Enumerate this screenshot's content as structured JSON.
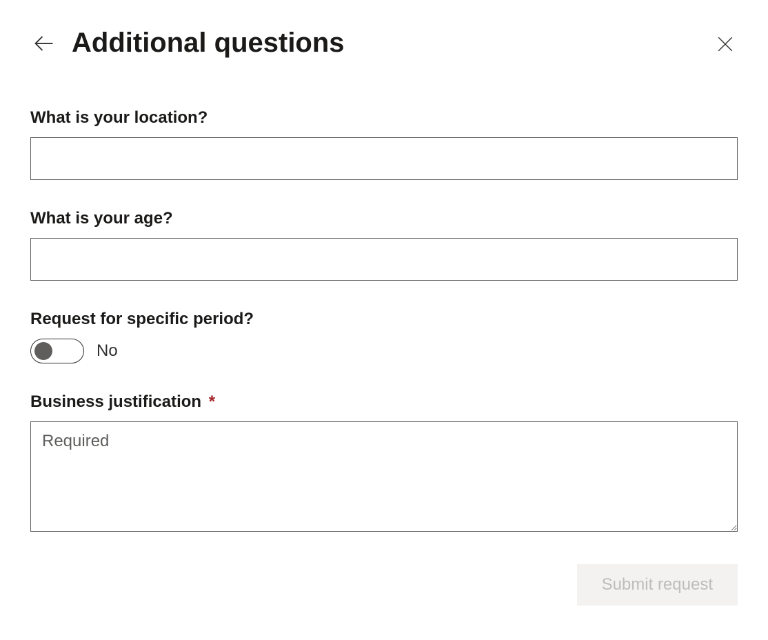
{
  "header": {
    "title": "Additional questions"
  },
  "fields": {
    "location": {
      "label": "What is your location?",
      "value": ""
    },
    "age": {
      "label": "What is your age?",
      "value": ""
    },
    "specificPeriod": {
      "label": "Request for specific period?",
      "value": "No"
    },
    "justification": {
      "label": "Business justification",
      "requiredMark": "*",
      "placeholder": "Required",
      "value": ""
    }
  },
  "actions": {
    "submit": "Submit request"
  }
}
